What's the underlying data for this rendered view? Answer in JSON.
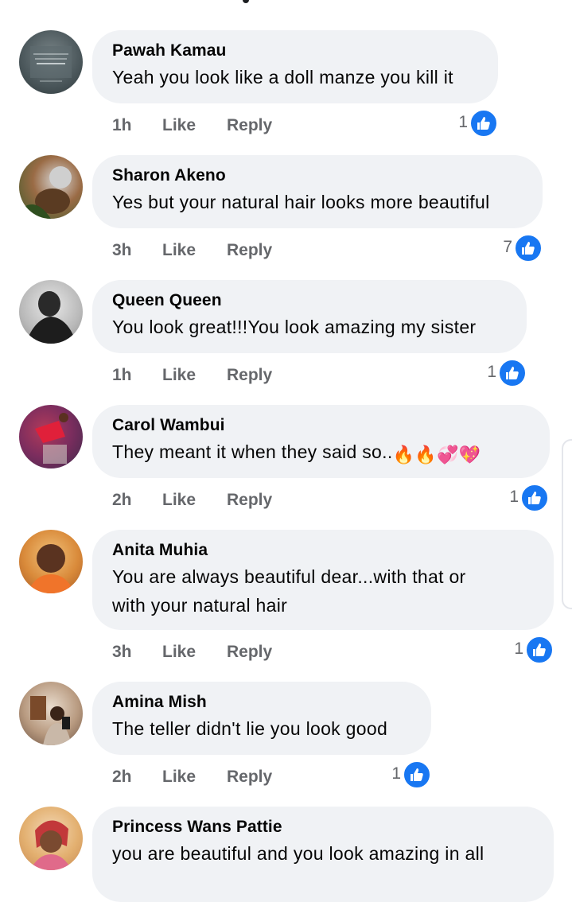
{
  "actions": {
    "like_label": "Like",
    "reply_label": "Reply"
  },
  "comments": [
    {
      "name": "Pawah Kamau",
      "lines": [
        "Yeah you look like a doll manze you kill it"
      ],
      "time": "1h",
      "reactions": "1"
    },
    {
      "name": "Sharon Akeno",
      "lines": [
        "Yes but your natural hair looks more beautiful"
      ],
      "time": "3h",
      "reactions": "7"
    },
    {
      "name": "Queen Queen",
      "lines": [
        "You look great!!!You look amazing my sister"
      ],
      "time": "1h",
      "reactions": "1"
    },
    {
      "name": "Carol Wambui",
      "lines": [
        "They meant it when they said so.."
      ],
      "emojis": [
        "🔥",
        "🔥",
        "💞",
        "💖"
      ],
      "time": "2h",
      "reactions": "1"
    },
    {
      "name": "Anita Muhia",
      "lines": [
        "You are always beautiful dear...with that or",
        "with your natural hair"
      ],
      "time": "3h",
      "reactions": "1"
    },
    {
      "name": "Amina Mish",
      "lines": [
        "The teller didn't lie you look good"
      ],
      "time": "2h",
      "reactions": "1"
    },
    {
      "name": "Princess Wans Pattie",
      "lines": [
        "you are beautiful and you look amazing in all"
      ],
      "time": "",
      "reactions": ""
    }
  ],
  "colors": {
    "bubble": "#f0f2f5",
    "like_blue": "#1877f2",
    "meta_gray": "#65676b"
  }
}
